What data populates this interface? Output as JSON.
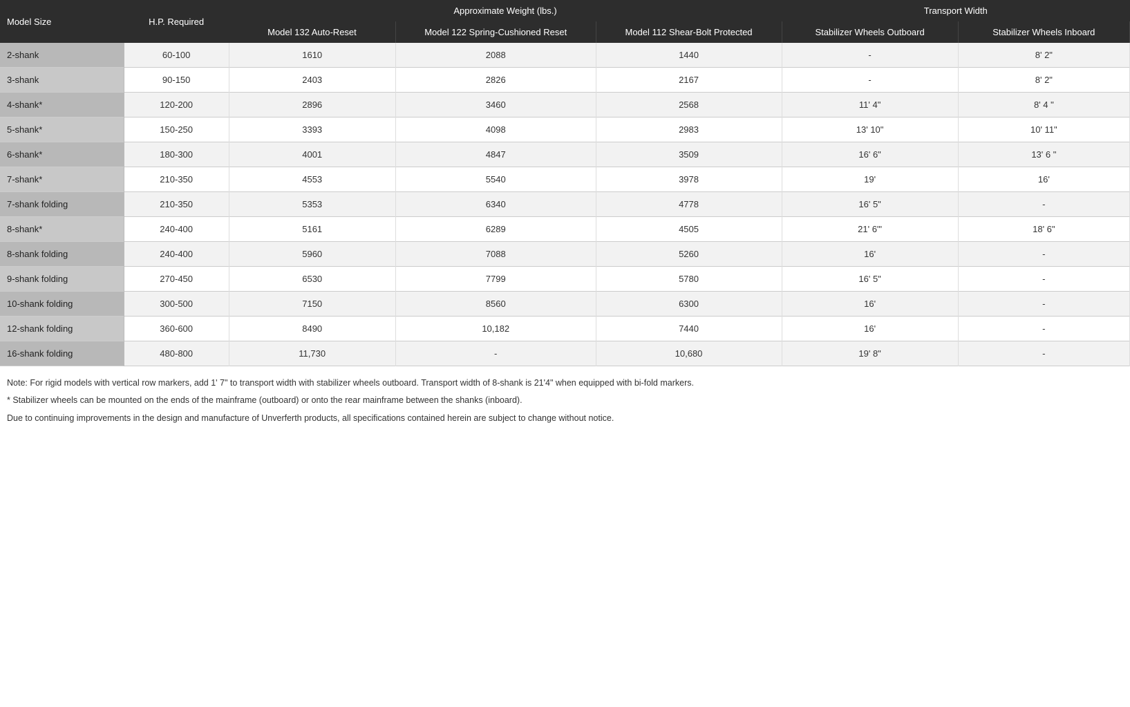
{
  "headers": {
    "group1": "Approximate Weight (lbs.)",
    "group2": "Transport Width",
    "col_model": "Model Size",
    "col_hp": "H.P. Required",
    "col_132": "Model 132 Auto-Reset",
    "col_122": "Model 122 Spring-Cushioned Reset",
    "col_112": "Model 112 Shear-Bolt Protected",
    "col_outboard": "Stabilizer Wheels Outboard",
    "col_inboard": "Stabilizer Wheels Inboard"
  },
  "rows": [
    {
      "model": "2-shank",
      "hp": "60-100",
      "w132": "1610",
      "w122": "2088",
      "w112": "1440",
      "outboard": "-",
      "inboard": "8' 2\""
    },
    {
      "model": "3-shank",
      "hp": "90-150",
      "w132": "2403",
      "w122": "2826",
      "w112": "2167",
      "outboard": "-",
      "inboard": "8' 2\""
    },
    {
      "model": "4-shank*",
      "hp": "120-200",
      "w132": "2896",
      "w122": "3460",
      "w112": "2568",
      "outboard": "11' 4\"",
      "inboard": "8' 4 \""
    },
    {
      "model": "5-shank*",
      "hp": "150-250",
      "w132": "3393",
      "w122": "4098",
      "w112": "2983",
      "outboard": "13' 10\"",
      "inboard": "10' 11\""
    },
    {
      "model": "6-shank*",
      "hp": "180-300",
      "w132": "4001",
      "w122": "4847",
      "w112": "3509",
      "outboard": "16' 6\"",
      "inboard": "13' 6 \""
    },
    {
      "model": "7-shank*",
      "hp": "210-350",
      "w132": "4553",
      "w122": "5540",
      "w112": "3978",
      "outboard": "19'",
      "inboard": "16'"
    },
    {
      "model": "7-shank folding",
      "hp": "210-350",
      "w132": "5353",
      "w122": "6340",
      "w112": "4778",
      "outboard": "16' 5\"",
      "inboard": "-"
    },
    {
      "model": "8-shank*",
      "hp": "240-400",
      "w132": "5161",
      "w122": "6289",
      "w112": "4505",
      "outboard": "21' 6'\"",
      "inboard": "18' 6\""
    },
    {
      "model": "8-shank folding",
      "hp": "240-400",
      "w132": "5960",
      "w122": "7088",
      "w112": "5260",
      "outboard": "16'",
      "inboard": "-"
    },
    {
      "model": "9-shank folding",
      "hp": "270-450",
      "w132": "6530",
      "w122": "7799",
      "w112": "5780",
      "outboard": "16' 5\"",
      "inboard": "-"
    },
    {
      "model": "10-shank folding",
      "hp": "300-500",
      "w132": "7150",
      "w122": "8560",
      "w112": "6300",
      "outboard": "16'",
      "inboard": "-"
    },
    {
      "model": "12-shank folding",
      "hp": "360-600",
      "w132": "8490",
      "w122": "10,182",
      "w112": "7440",
      "outboard": "16'",
      "inboard": "-"
    },
    {
      "model": "16-shank folding",
      "hp": "480-800",
      "w132": "11,730",
      "w122": "-",
      "w112": "10,680",
      "outboard": "19' 8\"",
      "inboard": "-"
    }
  ],
  "notes": [
    "Note: For rigid models with vertical row markers, add 1' 7\"  to  transport width with stabilizer wheels outboard. Transport width of 8-shank is 21'4\" when equipped with bi-fold markers.",
    "* Stabilizer wheels can be mounted on the ends of the mainframe (outboard) or onto the rear mainframe between the shanks (inboard).",
    "Due to continuing improvements in the design and manufacture of Unverferth products, all specifications contained herein are subject to change without notice."
  ]
}
